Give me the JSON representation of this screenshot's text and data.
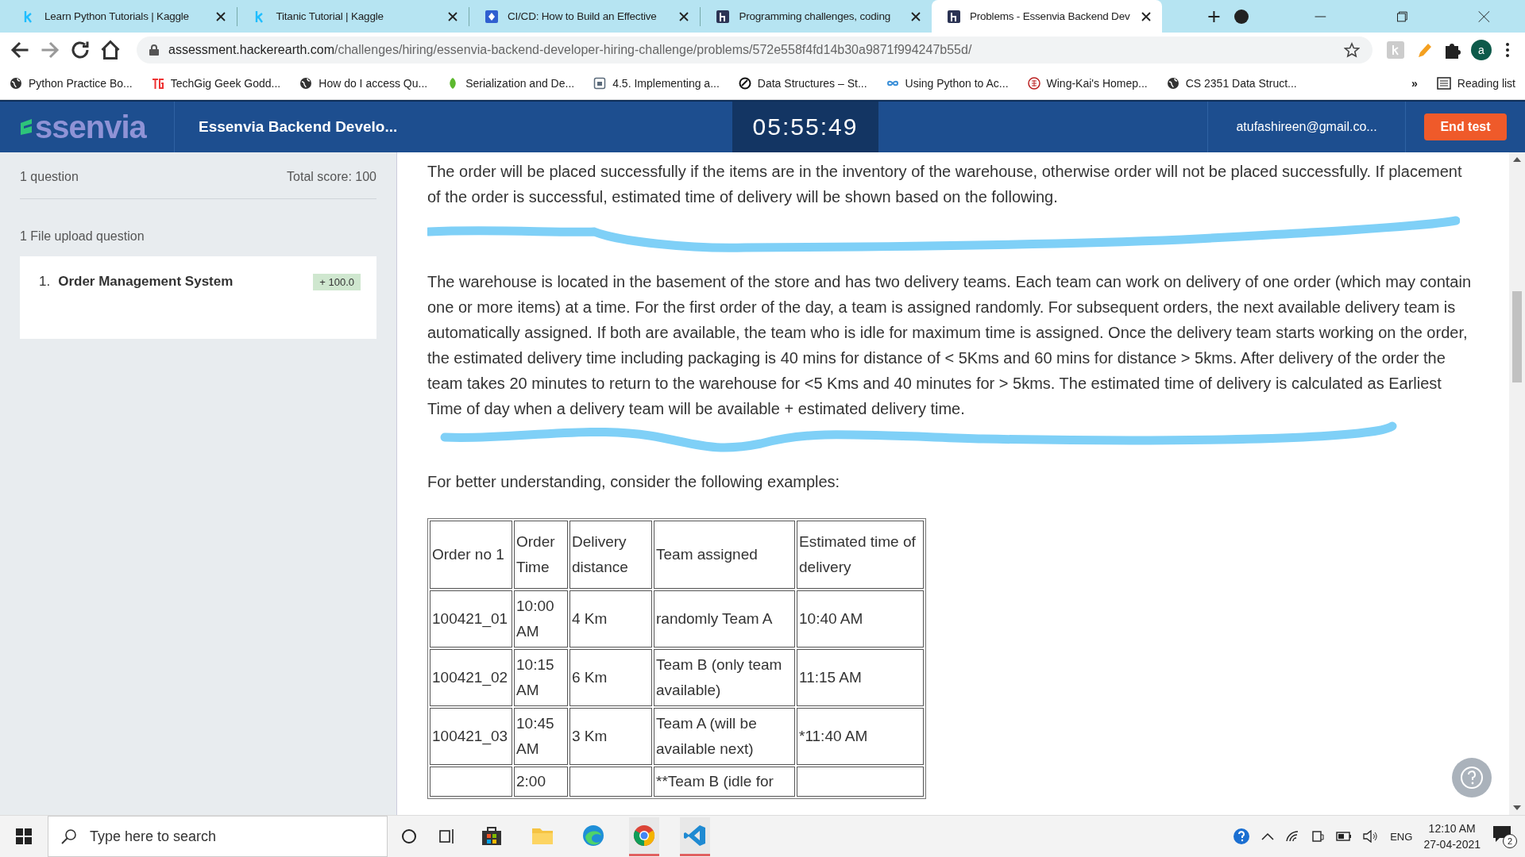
{
  "browser": {
    "tabs": [
      {
        "title": "Learn Python Tutorials | Kaggle",
        "selected": false
      },
      {
        "title": "Titanic Tutorial | Kaggle",
        "selected": false
      },
      {
        "title": "CI/CD: How to Build an Effective",
        "selected": false
      },
      {
        "title": "Programming challenges, coding",
        "selected": false
      },
      {
        "title": "Problems - Essenvia Backend Dev",
        "selected": true
      }
    ],
    "address": {
      "host": "assessment.hackerearth.com",
      "path": "/challenges/hiring/essenvia-backend-developer-hiring-challenge/problems/572e558f4fd14b30a9871f994247b55d/"
    },
    "profile_initial": "a",
    "bookmarks": [
      "Python Practice Bo...",
      "TechGig Geek Godd...",
      "How do I access Qu...",
      "Serialization and De...",
      "4.5. Implementing a...",
      "Data Structures – St...",
      "Using Python to Ac...",
      "Wing-Kai's Homep...",
      "CS 2351 Data Struct..."
    ],
    "more_bookmarks": "»",
    "reading_list": "Reading list"
  },
  "header": {
    "logo": "ssenvia",
    "test_title": "Essenvia Backend Develo...",
    "timer": "05:55:49",
    "email": "atufashireen@gmail.co...",
    "end_button": "End test"
  },
  "sidebar": {
    "question_count": "1 question",
    "total_score": "Total score: 100",
    "section": "1 File upload question",
    "questions": [
      {
        "number": "1.",
        "title": "Order Management System",
        "score": "+ 100.0"
      }
    ]
  },
  "content": {
    "paragraphs": [
      "The order will be placed successfully if the items are in the inventory of the warehouse, otherwise order will not be placed successfully. If placement of the order is successful, estimated time of delivery will be shown based on the following.",
      "The warehouse is located in the basement of the store and has two delivery teams. Each team can work on delivery of one order (which may contain one or more items) at a time. For the first order of the day, a team is assigned randomly. For subsequent orders, the next available delivery team is automatically assigned.  If both are available, the team who is idle for maximum time is assigned. Once the delivery team starts working on the order, the estimated delivery time including packaging is 40 mins for distance of < 5Kms and 60 mins for distance > 5kms. After delivery of the order the team takes 20 minutes to return to the warehouse for <5 Kms and 40 minutes for > 5kms.  The estimated time of delivery is calculated as Earliest Time of day when a delivery team will be available + estimated delivery time.",
      "For better understanding, consider the following examples:"
    ],
    "table": {
      "columns": [
        "Order no 1",
        "Order Time",
        "Delivery distance",
        "Team assigned",
        "Estimated time of delivery"
      ],
      "rows": [
        {
          "cells": [
            "100421_01",
            "10:00 AM",
            "4 Km",
            "randomly Team A",
            "10:40 AM"
          ]
        },
        {
          "cells": [
            "100421_02",
            "10:15 AM",
            "6 Km",
            "Team B (only team available)",
            "11:15 AM"
          ]
        },
        {
          "cells": [
            "100421_03",
            "10:45 AM",
            "3 Km",
            "Team A (will be available next)",
            "*11:40 AM"
          ]
        },
        {
          "cells": [
            null,
            "2:00",
            null,
            "**Team B (idle for",
            null
          ]
        }
      ]
    }
  },
  "taskbar": {
    "search_placeholder": "Type here to search",
    "language": "ENG",
    "time": "12:10 AM",
    "date": "27-04-2021",
    "notifications": "2"
  }
}
